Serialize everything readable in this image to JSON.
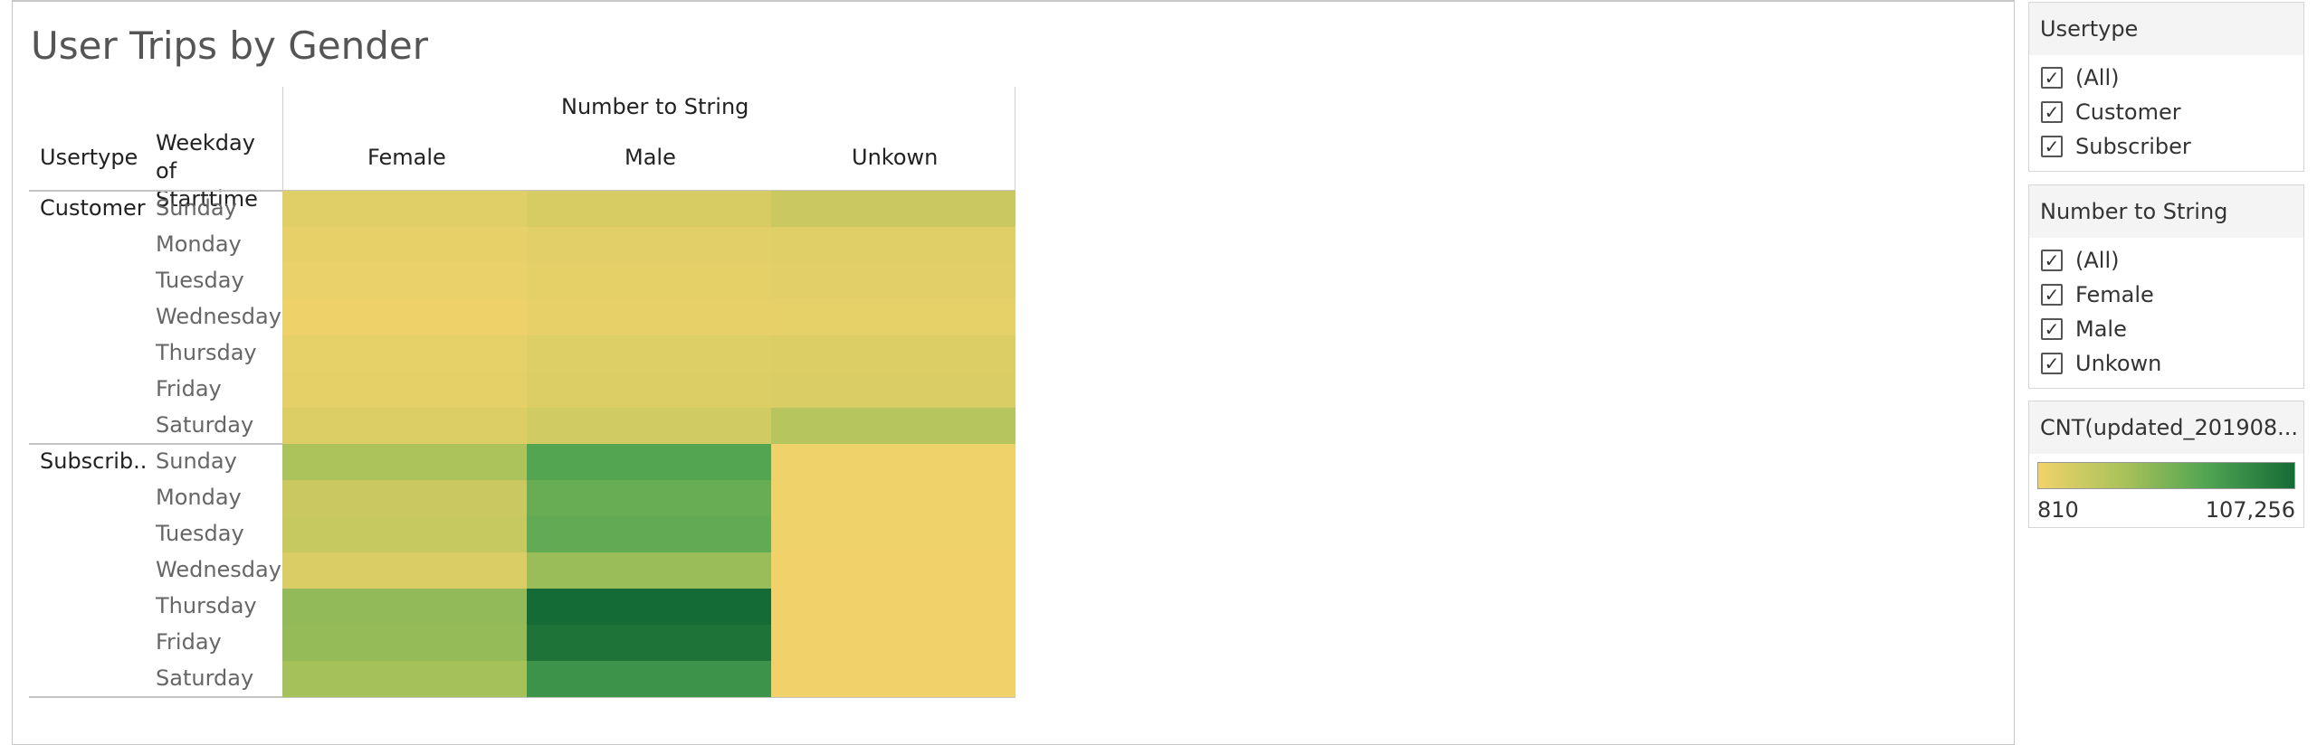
{
  "title": "User Trips by Gender",
  "column_header": "Number to String",
  "row_headers": {
    "usertype": "Usertype",
    "weekday": "Weekday of Starttime"
  },
  "genders": [
    "Female",
    "Male",
    "Unkown"
  ],
  "groups": [
    {
      "label": "Customer",
      "days": [
        "Sunday",
        "Monday",
        "Tuesday",
        "Wednesday",
        "Thursday",
        "Friday",
        "Saturday"
      ]
    },
    {
      "label": "Subscrib..",
      "days": [
        "Sunday",
        "Monday",
        "Tuesday",
        "Wednesday",
        "Thursday",
        "Friday",
        "Saturday"
      ]
    }
  ],
  "chart_data": {
    "type": "heatmap",
    "title": "User Trips by Gender",
    "columns": [
      "Female",
      "Male",
      "Unkown"
    ],
    "rows": [
      "Customer / Sunday",
      "Customer / Monday",
      "Customer / Tuesday",
      "Customer / Wednesday",
      "Customer / Thursday",
      "Customer / Friday",
      "Customer / Saturday",
      "Subscriber / Sunday",
      "Subscriber / Monday",
      "Subscriber / Tuesday",
      "Subscriber / Wednesday",
      "Subscriber / Thursday",
      "Subscriber / Friday",
      "Subscriber / Saturday"
    ],
    "values": [
      [
        9000,
        13500,
        20000
      ],
      [
        5000,
        7500,
        9000
      ],
      [
        4000,
        6500,
        8000
      ],
      [
        2500,
        5500,
        6000
      ],
      [
        6000,
        10000,
        11000
      ],
      [
        6500,
        11000,
        12000
      ],
      [
        11000,
        16500,
        30000
      ],
      [
        35000,
        70000,
        1500
      ],
      [
        20000,
        62000,
        1200
      ],
      [
        22000,
        64000,
        1100
      ],
      [
        12000,
        42000,
        1000
      ],
      [
        45000,
        107256,
        900
      ],
      [
        44000,
        102000,
        810
      ],
      [
        38000,
        82000,
        1000
      ]
    ],
    "color_scale": {
      "min": 810,
      "max": 107256,
      "min_label": "810",
      "max_label": "107,256",
      "stops": [
        "#f1d26a",
        "#a9c25a",
        "#4fa352",
        "#156b35"
      ]
    }
  },
  "filters": {
    "usertype": {
      "title": "Usertype",
      "items": [
        "(All)",
        "Customer",
        "Subscriber"
      ]
    },
    "number_to_string": {
      "title": "Number to String",
      "items": [
        "(All)",
        "Female",
        "Male",
        "Unkown"
      ]
    }
  },
  "legend": {
    "title": "CNT(updated_201908...",
    "min_label": "810",
    "max_label": "107,256"
  },
  "checkmark": "✓"
}
